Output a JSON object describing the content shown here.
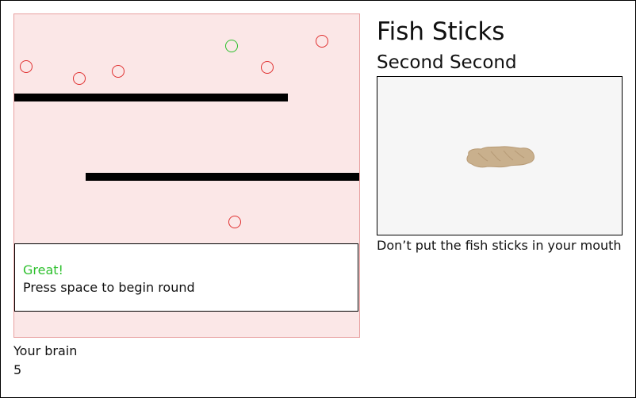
{
  "app": {
    "title": "Fish Sticks",
    "subtitle": "Second Second"
  },
  "game": {
    "status_text": "Great!",
    "status_color": "#2dc02d",
    "instruction_text": "Press space to begin round",
    "background_color": "#fbe7e7",
    "circle_color": "#e03030",
    "target_color": "#2dc02d"
  },
  "score": {
    "label": "Your brain",
    "value": "5"
  },
  "panel": {
    "image_icon": "fish-stick-image",
    "caption": "Don’t put the fish sticks in your mouth"
  }
}
